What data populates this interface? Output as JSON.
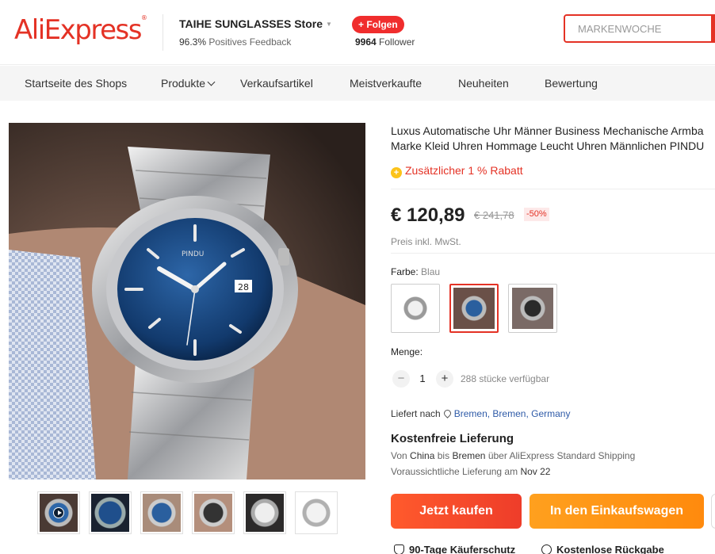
{
  "header": {
    "logo": "AliExpress",
    "store_name": "TAIHE SUNGLASSES Store",
    "feedback_pct": "96.3%",
    "feedback_label": "Positives Feedback",
    "follow_label": "+ Folgen",
    "followers_count": "9964",
    "followers_label": "Follower",
    "search_placeholder": "MARKENWOCHE"
  },
  "nav": {
    "items": [
      {
        "label": "Startseite des Shops"
      },
      {
        "label": "Produkte"
      },
      {
        "label": "Verkaufsartikel"
      },
      {
        "label": "Meistverkaufte"
      },
      {
        "label": "Neuheiten"
      },
      {
        "label": "Bewertung"
      }
    ]
  },
  "product": {
    "title_line1": "Luxus Automatische Uhr Männer Business Mechanische Armba",
    "title_line2": "Marke Kleid Uhren Hommage Leucht Uhren Männlichen PINDU",
    "extra_discount": "Zusätzlicher 1 % Rabatt",
    "coin_icon": "coin-icon",
    "price": "€ 120,89",
    "old_price": "€ 241,78",
    "discount_pct": "-50%",
    "vat_note": "Preis inkl. MwSt.",
    "color_label": "Farbe:",
    "color_value": "Blau",
    "qty_label": "Menge:",
    "qty_minus": "−",
    "qty_value": "1",
    "qty_plus": "+",
    "stock": "288 stücke verfügbar",
    "deliver_label": "Liefert nach",
    "deliver_city1": "Bremen,",
    "deliver_city2": "Bremen,",
    "deliver_country": "Germany",
    "free_shipping": "Kostenfreie Lieferung",
    "ship_from_pre": "Von",
    "ship_from": "China",
    "ship_to_pre": "bis",
    "ship_to": "Bremen",
    "ship_via": "über AliExpress Standard Shipping",
    "eta_label": "Voraussichtliche Lieferung am",
    "eta_date": "Nov 22",
    "buy_now": "Jetzt kaufen",
    "add_to_cart": "In den Einkaufswagen",
    "protection": "90-Tage Käuferschutz",
    "returns": "Kostenlose Rückgabe"
  },
  "colors": {
    "brand": "#e43225",
    "buy": "#ff5a2c",
    "cart": "#ffa01e",
    "link": "#2f5ba8"
  }
}
